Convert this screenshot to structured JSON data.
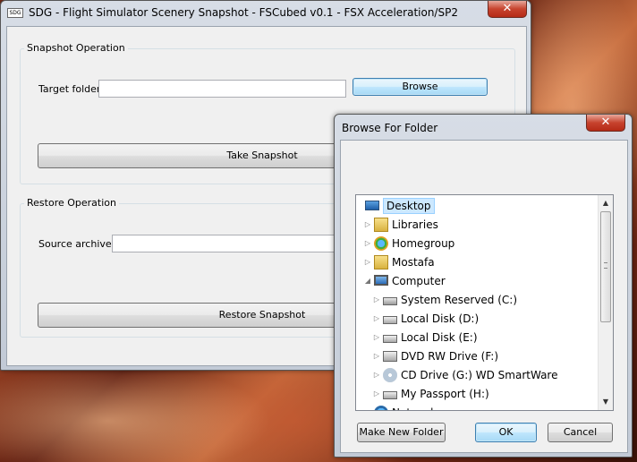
{
  "main_window": {
    "title": "SDG - Flight Simulator Scenery Snapshot - FSCubed v0.1 - FSX Acceleration/SP2",
    "app_icon_text": "SDG",
    "close_label": "✕",
    "snapshot": {
      "group_label": "Snapshot Operation",
      "target_folder_label": "Target folder",
      "target_folder_value": "",
      "browse_label": "Browse",
      "take_snapshot_label": "Take Snapshot"
    },
    "restore": {
      "group_label": "Restore Operation",
      "source_archive_label": "Source archive",
      "source_archive_value": "",
      "restore_snapshot_label": "Restore Snapshot"
    }
  },
  "browse_dialog": {
    "title": "Browse For Folder",
    "close_label": "✕",
    "tree": [
      {
        "label": "Desktop",
        "icon": "desktop-icon",
        "level": 0,
        "selected": true,
        "expander": "none"
      },
      {
        "label": "Libraries",
        "icon": "libraries-icon",
        "level": 1,
        "expander": "collapsed"
      },
      {
        "label": "Homegroup",
        "icon": "homegroup-icon",
        "level": 1,
        "expander": "collapsed"
      },
      {
        "label": "Mostafa",
        "icon": "user-folder-icon",
        "level": 1,
        "expander": "collapsed"
      },
      {
        "label": "Computer",
        "icon": "computer-icon",
        "level": 1,
        "expander": "expanded"
      },
      {
        "label": "System Reserved (C:)",
        "icon": "windows-drive-icon",
        "level": 2,
        "expander": "collapsed"
      },
      {
        "label": "Local Disk (D:)",
        "icon": "hard-drive-icon",
        "level": 2,
        "expander": "collapsed"
      },
      {
        "label": "Local Disk (E:)",
        "icon": "hard-drive-icon",
        "level": 2,
        "expander": "collapsed"
      },
      {
        "label": "DVD RW Drive (F:)",
        "icon": "dvd-drive-icon",
        "level": 2,
        "expander": "collapsed"
      },
      {
        "label": "CD Drive (G:) WD SmartWare",
        "icon": "cd-drive-icon",
        "level": 2,
        "expander": "collapsed"
      },
      {
        "label": "My Passport (H:)",
        "icon": "hard-drive-icon",
        "level": 2,
        "expander": "collapsed"
      },
      {
        "label": "Network",
        "icon": "network-icon",
        "level": 1,
        "expander": "collapsed"
      }
    ],
    "make_new_folder_label": "Make New Folder",
    "ok_label": "OK",
    "cancel_label": "Cancel"
  }
}
